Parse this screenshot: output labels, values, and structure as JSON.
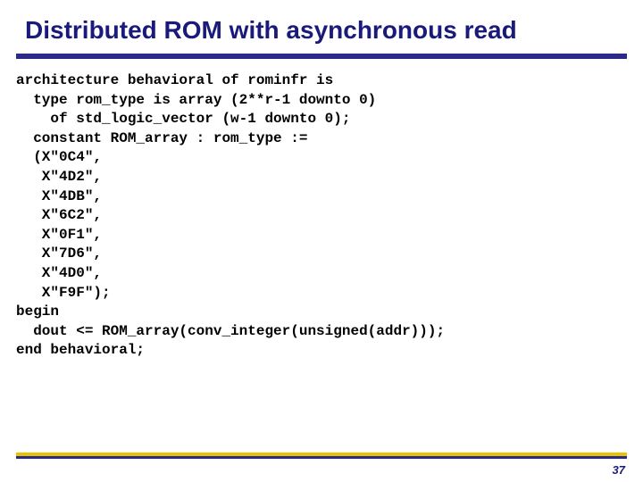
{
  "title": "Distributed ROM with asynchronous read",
  "code": {
    "l01": "architecture behavioral of rominfr is",
    "l02": "  type rom_type is array (2**r-1 downto 0)",
    "l03": "    of std_logic_vector (w-1 downto 0);",
    "l04": "  constant ROM_array : rom_type := ",
    "l05": "  (X\"0C4\",",
    "l06": "   X\"4D2\",",
    "l07": "   X\"4DB\",",
    "l08": "   X\"6C2\",",
    "l09": "   X\"0F1\",",
    "l10": "   X\"7D6\",",
    "l11": "   X\"4D0\",",
    "l12": "   X\"F9F\");",
    "l13": "begin",
    "l14": "  dout <= ROM_array(conv_integer(unsigned(addr))); ",
    "l15": "end behavioral;"
  },
  "page_number": "37"
}
